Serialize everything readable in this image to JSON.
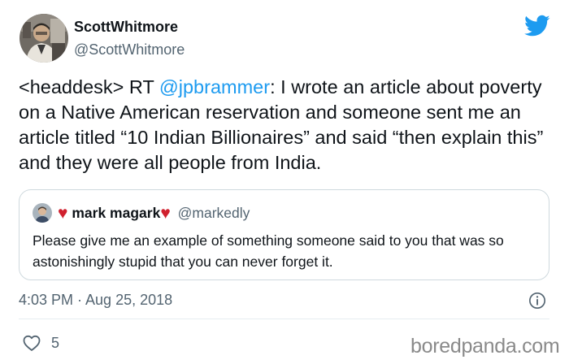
{
  "author": {
    "display_name": "ScottWhitmore",
    "handle": "@ScottWhitmore"
  },
  "tweet": {
    "text_before_mention": "<headdesk> RT ",
    "mention": "@jpbrammer",
    "text_after_mention": ": I wrote an article about poverty on a Native American reservation and someone sent me an article titled “10 Indian Billionaires” and said “then explain this” and they were all people from India.",
    "timestamp": "4:03 PM · Aug 25, 2018",
    "like_count": "5"
  },
  "quoted_tweet": {
    "heart_left": "♥",
    "name": "mark magark",
    "heart_right": "♥",
    "handle": "@markedly",
    "text": "Please give me an example of something someone said to you that was so astonishingly stupid that you can never forget it."
  },
  "watermark": "boredpanda.com",
  "colors": {
    "accent": "#1d9bf0",
    "heart": "#d0202e",
    "secondary_text": "#536471",
    "border": "#cfd9de"
  },
  "icons": {
    "brand": "twitter-bird-icon",
    "info": "info-icon",
    "like": "heart-outline-icon"
  }
}
